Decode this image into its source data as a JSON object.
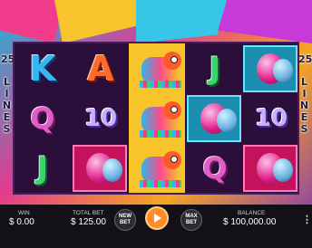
{
  "lines": {
    "count_top": "25",
    "label": "LINES"
  },
  "reels": [
    [
      "K",
      "Q",
      "J"
    ],
    [
      "A",
      "10",
      "balloon"
    ],
    [
      "pinata",
      "pinata",
      "pinata"
    ],
    [
      "J",
      "balloon",
      "Q"
    ],
    [
      "balloon",
      "10",
      "balloon"
    ]
  ],
  "footer": {
    "win_label": "WIN",
    "win_value": "$ 0.00",
    "total_bet_label": "TOTAL BET",
    "total_bet_value": "$ 125.00",
    "new_bet_label": "NEW BET",
    "max_bet_label": "MAX BET",
    "balance_label": "BALANCE",
    "balance_value": "$ 100,000.00",
    "info_glyph": "⋮"
  },
  "colors": {
    "spin": "#ff8c2b",
    "footer_bg": "#141018",
    "reel_bg": "#2b0f3a"
  }
}
